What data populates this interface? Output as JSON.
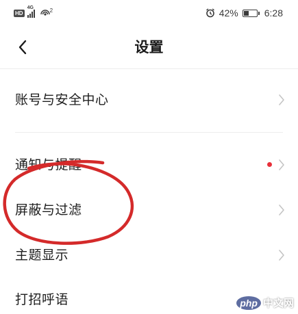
{
  "status_bar": {
    "network_badge": "HD",
    "signal_label": "4G",
    "wifi_badge": "2",
    "battery_percent_text": "42%",
    "battery_level": 0.42,
    "time": "6:28",
    "icons": [
      "hd-icon",
      "signal-icon",
      "wifi-icon",
      "alarm-icon",
      "battery-icon"
    ]
  },
  "navbar": {
    "back_icon": "chevron-left-icon",
    "title": "设置"
  },
  "settings": {
    "items": [
      {
        "label": "账号与安全中心",
        "has_dot": false
      },
      {
        "label": "通知与提醒",
        "has_dot": true
      },
      {
        "label": "屏蔽与过滤",
        "has_dot": false
      },
      {
        "label": "主题显示",
        "has_dot": false
      },
      {
        "label": "打招呼语",
        "has_dot": false
      }
    ]
  },
  "annotation": {
    "type": "hand-drawn circle",
    "color": "#d42a2a",
    "target": "屏蔽与过滤"
  },
  "watermark": {
    "logo_text": "php",
    "text": "中文网"
  },
  "colors": {
    "accent_dot": "#e8303a",
    "annotation": "#d42a2a",
    "text": "#1e1e1e",
    "chevron": "#c4c4c4"
  }
}
